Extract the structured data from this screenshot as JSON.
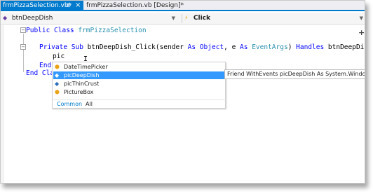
{
  "tabs": {
    "active_label": "frmPizzaSelection.vb*",
    "design_label": "frmPizzaSelection.vb [Design]*",
    "pin_glyph": "⊕",
    "close_glyph": "×"
  },
  "navbar": {
    "object_combo": "btnDeepDish",
    "event_combo": "Click",
    "dropdown_glyph": "▼"
  },
  "code": {
    "line1_kw": "Public Class ",
    "line1_name": "frmPizzaSelection",
    "line3_a": "Private Sub ",
    "line3_b": "btnDeepDish_Click(sender ",
    "line3_c": "As ",
    "line3_d": "Object",
    "line3_e": ", e ",
    "line3_f": "As ",
    "line3_g": "EventArgs",
    "line3_h": ") ",
    "line3_i": "Handles",
    "line3_j": " btnDeepDish.Click",
    "line4_text": "pic",
    "line5_kw": "End",
    "line6_kw": "End Clas",
    "add_glyph": "+",
    "caret_glyph": "I"
  },
  "intellisense": {
    "items": [
      {
        "label": "DateTimePicker",
        "icon": "class-icon"
      },
      {
        "label": "picDeepDish",
        "icon": "field-icon",
        "selected": true
      },
      {
        "label": "picThinCrust",
        "icon": "field-icon"
      },
      {
        "label": "PictureBox",
        "icon": "class-icon"
      }
    ],
    "filter_common": "Common",
    "filter_all": "All"
  },
  "tooltip": "Friend WithEvents picDeepDish As System.Windows.",
  "colors": {
    "accent": "#007acc",
    "selection": "#3399ff",
    "keyword": "#0000ff",
    "type": "#2b91af"
  }
}
